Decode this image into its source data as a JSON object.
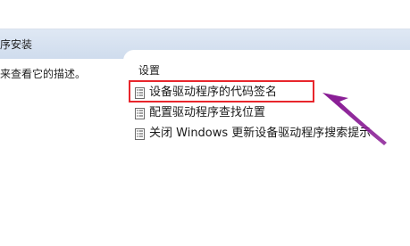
{
  "header": {
    "title": "序安装"
  },
  "left_pane": {
    "description": "来查看它的描述。"
  },
  "settings": {
    "heading": "设置",
    "items": [
      {
        "label": "设备驱动程序的代码签名",
        "icon": "policy-document-icon"
      },
      {
        "label": "配置驱动程序查找位置",
        "icon": "policy-document-icon"
      },
      {
        "label": "关闭 Windows 更新设备驱动程序搜索提示",
        "icon": "policy-document-icon"
      }
    ]
  },
  "annotations": {
    "highlight_color": "#e8262c",
    "arrow_color": "#8a1f96"
  }
}
